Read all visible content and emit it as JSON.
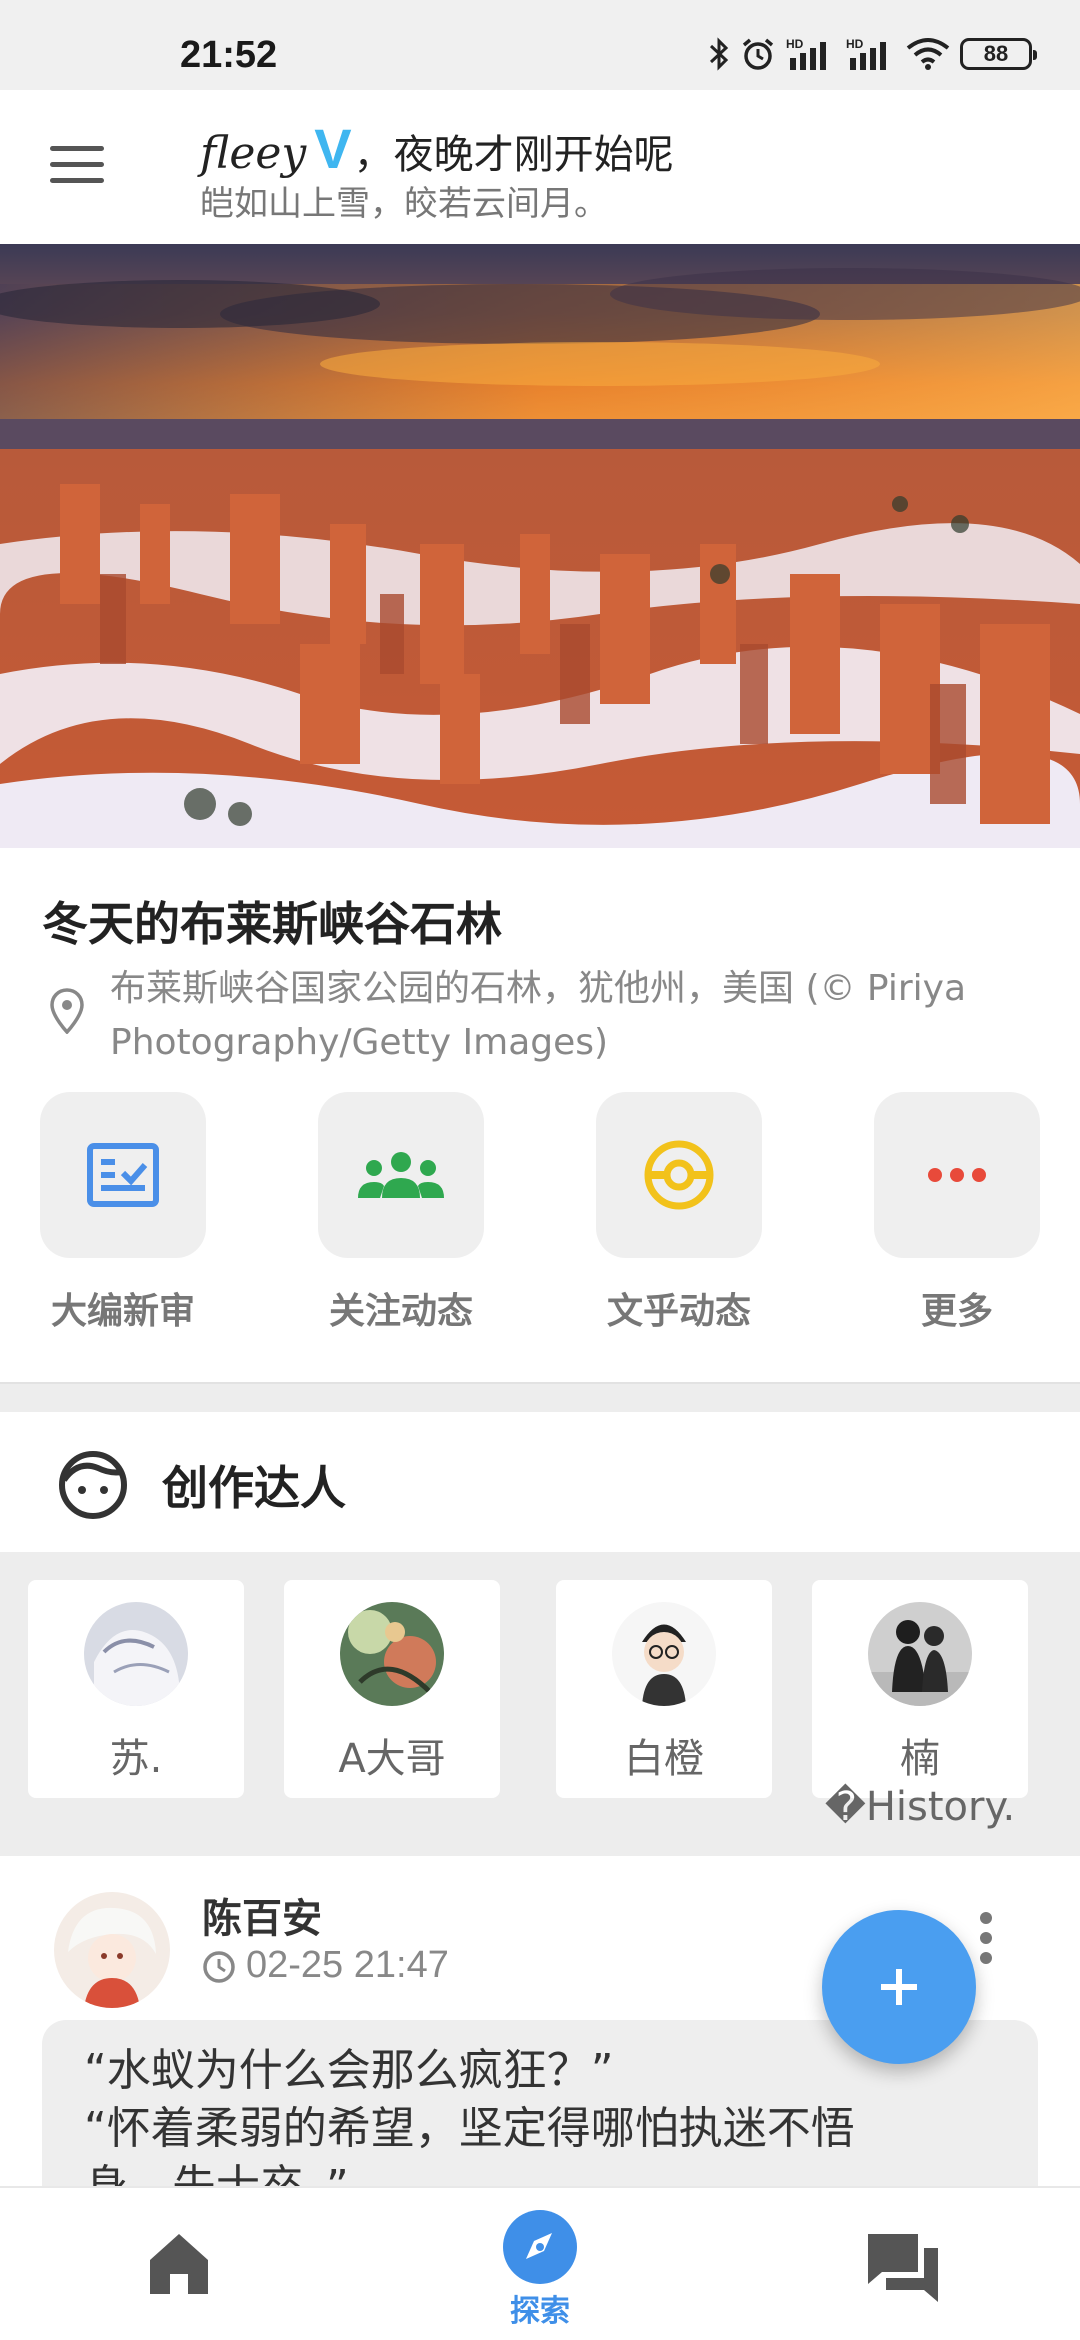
{
  "status_bar": {
    "time": "21:52",
    "battery": "88",
    "icons": [
      "bluetooth-icon",
      "alarm-icon",
      "signal-hd-icon",
      "signal-hd-icon",
      "wifi-icon",
      "battery-icon"
    ]
  },
  "header": {
    "brand": "fleey",
    "brand_badge": "V",
    "greeting": "，夜晚才刚开始呢",
    "motto": "皑如山上雪，皎若云间月。"
  },
  "hero": {
    "title": "冬天的布莱斯峡谷石林",
    "caption": "布莱斯峡谷国家公园的石林，犹他州，美国 (© Piriya Photography/Getty Images)"
  },
  "quick_actions": [
    {
      "label": "大编新审",
      "icon": "review-checklist-icon",
      "color": "#4a8fe8"
    },
    {
      "label": "关注动态",
      "icon": "group-icon",
      "color": "#2fa84f"
    },
    {
      "label": "文乎动态",
      "icon": "pokeball-icon",
      "color": "#f2c21b"
    },
    {
      "label": "更多",
      "icon": "more-dots-icon",
      "color": "#e84a3a"
    }
  ],
  "creators": {
    "title": "创作达人",
    "items": [
      {
        "name": "苏."
      },
      {
        "name": "A大哥"
      },
      {
        "name": "白橙"
      },
      {
        "name": "楠�History."
      }
    ]
  },
  "post": {
    "author": "陈百安",
    "time": "02-25 21:47",
    "line1": "“水蚁为什么会那么疯狂？”",
    "line2": "“怀着柔弱的希望，坚定得哪怕执迷不悟",
    "line3": "身，先士卒。”"
  },
  "bottom_nav": {
    "explore_label": "探索"
  },
  "colors": {
    "accent": "#3f8fe8",
    "fab": "#4a9ef0"
  }
}
